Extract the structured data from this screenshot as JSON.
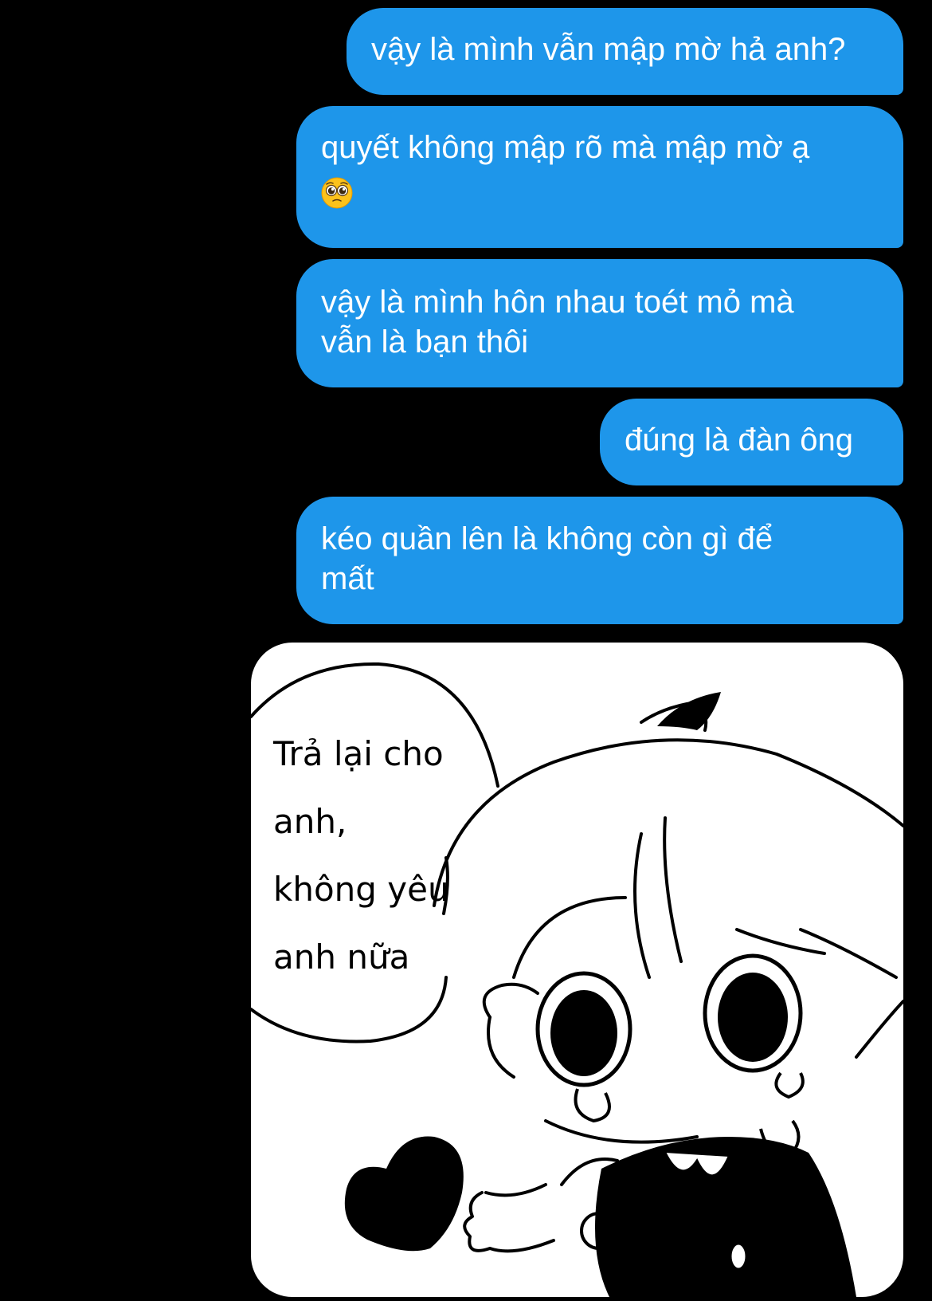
{
  "messages": [
    {
      "lines": [
        "vậy là mình vẫn mập mờ hả anh?"
      ]
    },
    {
      "lines": [
        "quyết không mập rõ mà mập mờ ạ"
      ],
      "emoji": "pleading-face-icon"
    },
    {
      "lines": [
        "vậy là mình hôn nhau toét mỏ mà",
        "vẫn là bạn thôi"
      ]
    },
    {
      "lines": [
        "đúng là đàn ông"
      ]
    },
    {
      "lines": [
        "kéo quần lên là không còn gì để",
        "mất"
      ]
    }
  ],
  "sticker": {
    "caption_lines": [
      "Trả lại cho",
      "anh,",
      "không yêu",
      "anh nữa"
    ],
    "icons": [
      "speech-bubble-icon",
      "heart-icon",
      "crying-chibi-character"
    ]
  },
  "colors": {
    "background": "#000000",
    "outgoing_bubble": "#1e96ea",
    "bubble_text": "#ffffff",
    "sticker_background": "#ffffff"
  }
}
